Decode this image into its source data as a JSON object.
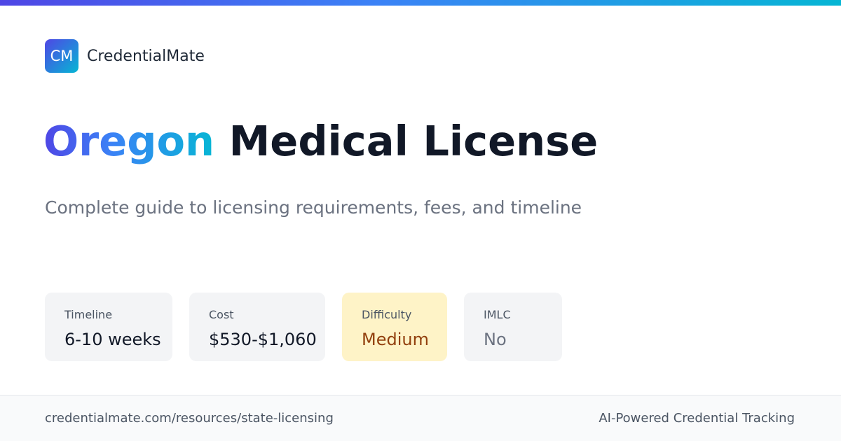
{
  "brand": {
    "logo_text": "CM",
    "name": "CredentialMate"
  },
  "headline": {
    "state": "Oregon",
    "rest": "Medical License"
  },
  "subtitle": "Complete guide to licensing requirements, fees, and timeline",
  "stats": {
    "timeline": {
      "label": "Timeline",
      "value": "6-10 weeks"
    },
    "cost": {
      "label": "Cost",
      "value": "$530-$1,060"
    },
    "difficulty": {
      "label": "Difficulty",
      "value": "Medium"
    },
    "imlc": {
      "label": "IMLC",
      "value": "No"
    }
  },
  "footer": {
    "url": "credentialmate.com/resources/state-licensing",
    "tagline": "AI-Powered Credential Tracking"
  },
  "colors": {
    "accent_start": "#4f46e5",
    "accent_end": "#06b6d4",
    "difficulty_bg": "#fef3c7",
    "difficulty_text": "#92400e"
  }
}
